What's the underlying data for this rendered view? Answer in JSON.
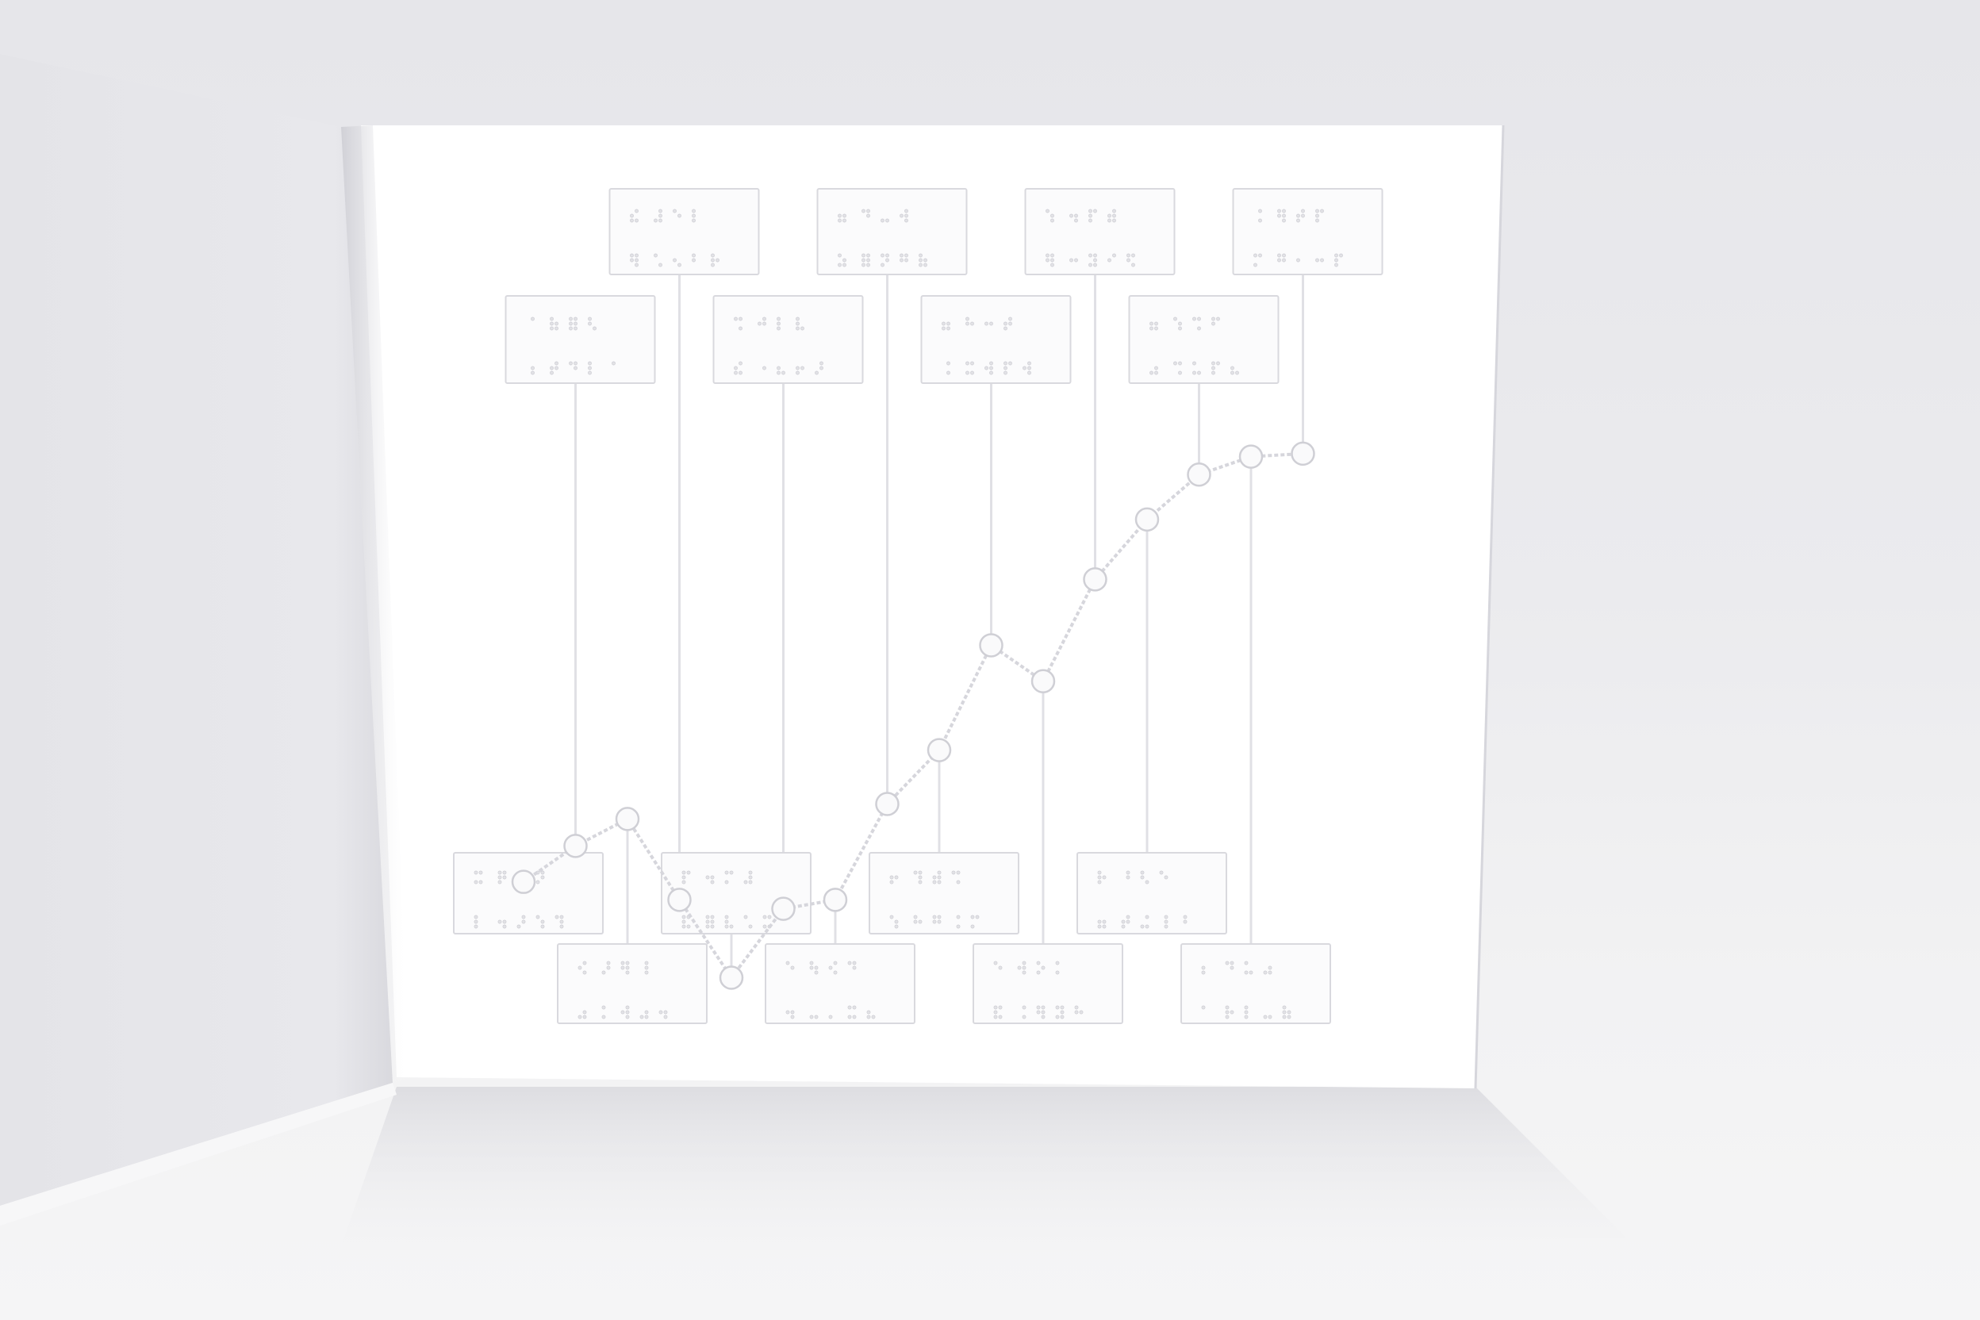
{
  "photo": {
    "subject": "open-booklet",
    "background_color": "#ececef",
    "paper_color": "#ffffff",
    "left_page_color": "#e9e9ed"
  },
  "chart_data": {
    "type": "line",
    "x": [
      1,
      2,
      3,
      4,
      5,
      6,
      7,
      8,
      9,
      10,
      11,
      12,
      13,
      14,
      15,
      16
    ],
    "values": [
      4.15,
      4.75,
      5.2,
      3.85,
      2.55,
      3.7,
      3.85,
      5.45,
      6.35,
      8.1,
      7.5,
      9.2,
      10.2,
      10.95,
      11.25,
      11.3
    ],
    "ylim": [
      0,
      14
    ],
    "grid": false,
    "legend": "none",
    "annotation_label_text": ""
  }
}
